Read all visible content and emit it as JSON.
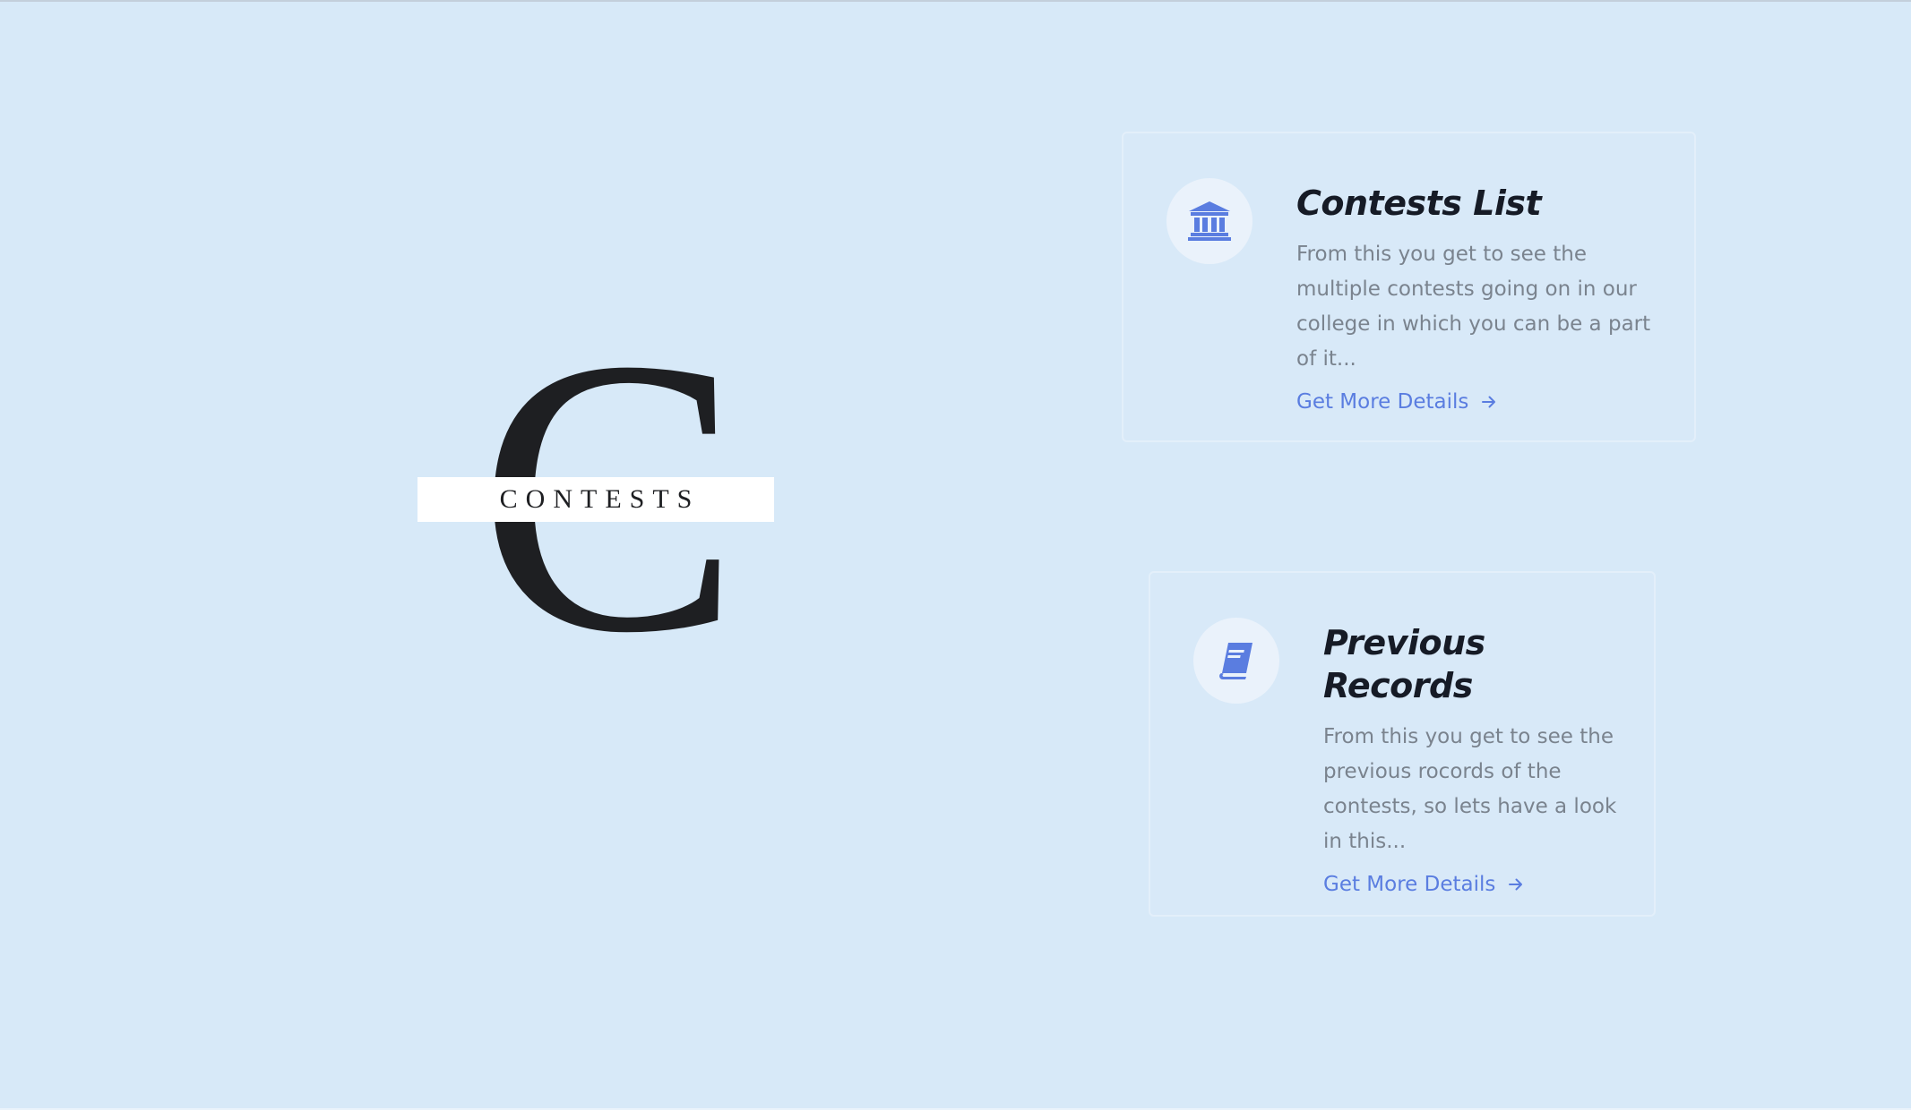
{
  "logo": {
    "letter": "C",
    "word": "CONTESTS"
  },
  "cards": [
    {
      "title": "Contests List",
      "description": "From this you get to see the multiple contests going on in our college in which you can be a part of it...",
      "link_label": "Get More Details",
      "icon": "bank-icon"
    },
    {
      "title": "Previous Records",
      "description": "From this you get to see the previous rocords of the contests, so lets have a look in this...",
      "link_label": "Get More Details",
      "icon": "book-icon"
    }
  ],
  "colors": {
    "background": "#d7e9f8",
    "accent": "#5a7de0",
    "title": "#161b26",
    "text": "#7a838e"
  }
}
